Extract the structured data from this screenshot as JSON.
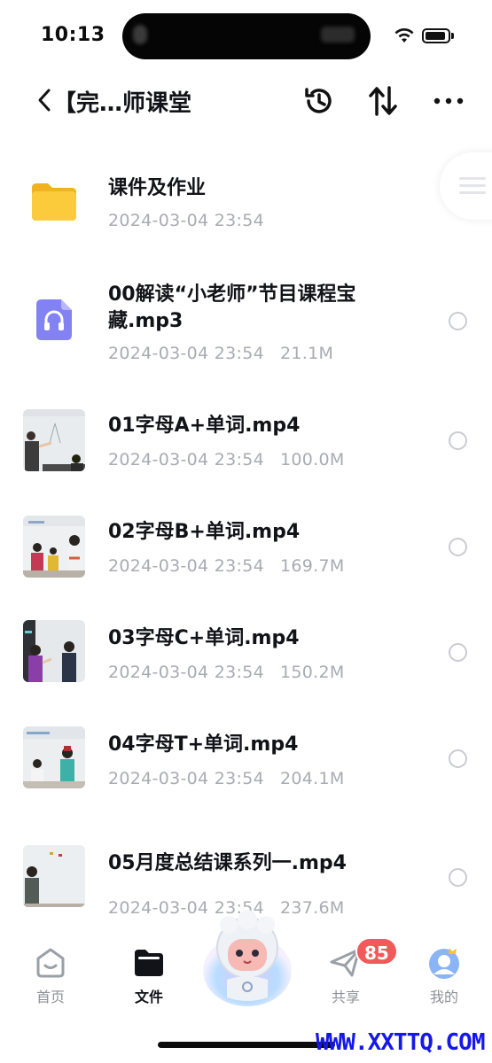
{
  "status": {
    "time": "10:13"
  },
  "nav": {
    "title": "【完…师课堂"
  },
  "files": [
    {
      "name": "课件及作业",
      "date": "2024-03-04 23:54",
      "size": "",
      "type": "folder"
    },
    {
      "name": "00解读“小老师”节目课程宝藏.mp3",
      "date": "2024-03-04 23:54",
      "size": "21.1M",
      "type": "audio"
    },
    {
      "name": "01字母A+单词.mp4",
      "date": "2024-03-04 23:54",
      "size": "100.0M",
      "type": "video"
    },
    {
      "name": "02字母B+单词.mp4",
      "date": "2024-03-04 23:54",
      "size": "169.7M",
      "type": "video"
    },
    {
      "name": "03字母C+单词.mp4",
      "date": "2024-03-04 23:54",
      "size": "150.2M",
      "type": "video"
    },
    {
      "name": "04字母T+单词.mp4",
      "date": "2024-03-04 23:54",
      "size": "204.1M",
      "type": "video"
    },
    {
      "name": "05月度总结课系列一.mp4",
      "date": "2024-03-04 23:54",
      "size": "237.6M",
      "type": "video"
    }
  ],
  "tabs": [
    {
      "label": "首页",
      "icon": "home-icon"
    },
    {
      "label": "文件",
      "icon": "folder-tab-icon"
    },
    {
      "label": "共享",
      "icon": "send-icon"
    },
    {
      "label": "我的",
      "icon": "avatar-icon"
    }
  ],
  "share_badge": "85",
  "watermark": "WWW.XXTTQ.COM",
  "colors": {
    "accent": "#111318",
    "badge": "#f25a5a",
    "muted": "#a9abb3",
    "folder": "#f7c331",
    "audio": "#7e7ef5"
  }
}
